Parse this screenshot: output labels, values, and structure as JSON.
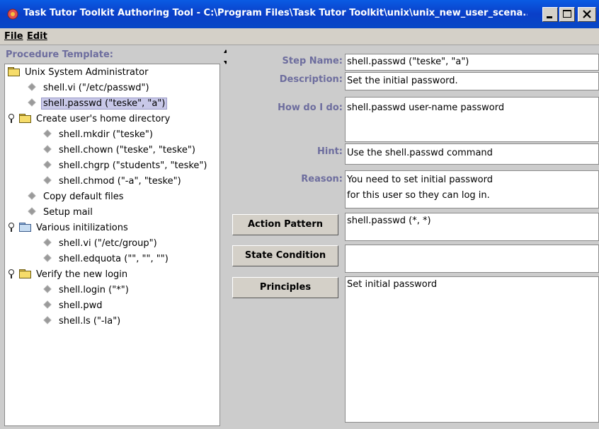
{
  "window": {
    "title": "Task Tutor Toolkit Authoring Tool - C:\\Program Files\\Task Tutor Toolkit\\unix\\unix_new_user_scena...",
    "icon": "app-icon",
    "buttons": {
      "minimize_icon": "minimize-icon",
      "maximize_icon": "maximize-icon",
      "close_icon": "close-icon"
    }
  },
  "menu": {
    "items": [
      "File",
      "Edit"
    ]
  },
  "procedure": {
    "header": "Procedure Template:",
    "tree": [
      {
        "label": "Unix System Administrator",
        "icon": "folder-icon",
        "level": 0
      },
      {
        "label": "shell.vi (\"/etc/passwd\")",
        "icon": "leaf-icon",
        "level": 1
      },
      {
        "label": "shell.passwd (\"teske\", \"a\")",
        "icon": "leaf-icon",
        "level": 1,
        "selected": true
      },
      {
        "label": "Create user's home directory",
        "icon": "folder-icon",
        "level": 1,
        "key": true
      },
      {
        "label": "shell.mkdir (\"teske\")",
        "icon": "leaf-icon",
        "level": 2
      },
      {
        "label": "shell.chown (\"teske\", \"teske\")",
        "icon": "leaf-icon",
        "level": 2
      },
      {
        "label": "shell.chgrp (\"students\", \"teske\")",
        "icon": "leaf-icon",
        "level": 2
      },
      {
        "label": "shell.chmod (\"-a\", \"teske\")",
        "icon": "leaf-icon",
        "level": 2
      },
      {
        "label": "Copy default files",
        "icon": "leaf-icon",
        "level": 1
      },
      {
        "label": "Setup mail",
        "icon": "leaf-icon",
        "level": 1
      },
      {
        "label": "Various initilizations",
        "icon": "folder-icon-blue",
        "level": 1,
        "key": true
      },
      {
        "label": "shell.vi (\"/etc/group\")",
        "icon": "leaf-icon",
        "level": 2
      },
      {
        "label": "shell.edquota (\"\", \"\", \"\")",
        "icon": "leaf-icon",
        "level": 2
      },
      {
        "label": "Verify the new login",
        "icon": "folder-icon",
        "level": 1,
        "key": true
      },
      {
        "label": "shell.login (\"*\")",
        "icon": "leaf-icon",
        "level": 2
      },
      {
        "label": "shell.pwd",
        "icon": "leaf-icon",
        "level": 2
      },
      {
        "label": "shell.ls (\"-la\")",
        "icon": "leaf-icon",
        "level": 2
      }
    ]
  },
  "details": {
    "step_name_label": "Step Name:",
    "step_name": "shell.passwd (\"teske\", \"a\")",
    "description_label": "Description:",
    "description": "Set the initial password.",
    "how_label": "How do I do:",
    "how": "shell.passwd user-name password",
    "hint_label": "Hint:",
    "hint": "Use the shell.passwd command",
    "reason_label": "Reason:",
    "reason": "You need to set initial password\nfor this user so they can log in.",
    "action_pattern_button": "Action Pattern",
    "action_pattern": "shell.passwd (*, *)",
    "state_condition_button": "State Condition",
    "state_condition": "",
    "principles_button": "Principles",
    "principles": "Set initial password"
  }
}
